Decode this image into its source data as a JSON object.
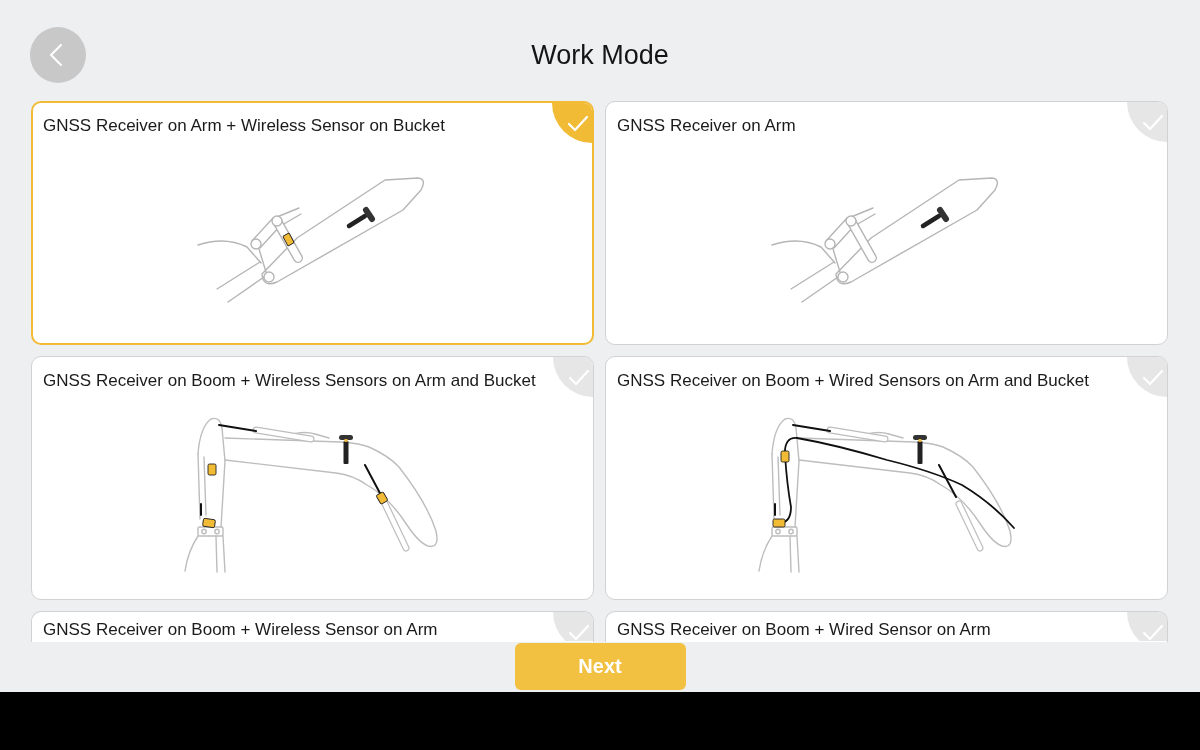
{
  "header": {
    "title": "Work Mode"
  },
  "cards": [
    {
      "title": "GNSS Receiver on Arm + Wireless Sensor on Bucket",
      "selected": true,
      "kind": "arm",
      "wireless_sensors": true,
      "wired_sensors": false
    },
    {
      "title": "GNSS Receiver on Arm",
      "selected": false,
      "kind": "arm",
      "wireless_sensors": false,
      "wired_sensors": false
    },
    {
      "title": "GNSS Receiver on Boom + Wireless Sensors on Arm and Bucket",
      "selected": false,
      "kind": "boom",
      "wireless_sensors": true,
      "wired_sensors": false
    },
    {
      "title": "GNSS Receiver on Boom + Wired Sensors on Arm and Bucket",
      "selected": false,
      "kind": "boom",
      "wireless_sensors": false,
      "wired_sensors": true
    },
    {
      "title": "GNSS Receiver on Boom + Wireless Sensor on Arm",
      "selected": false
    },
    {
      "title": "GNSS Receiver on Boom + Wired Sensor on Arm",
      "selected": false
    }
  ],
  "next_button": {
    "label": "Next"
  }
}
